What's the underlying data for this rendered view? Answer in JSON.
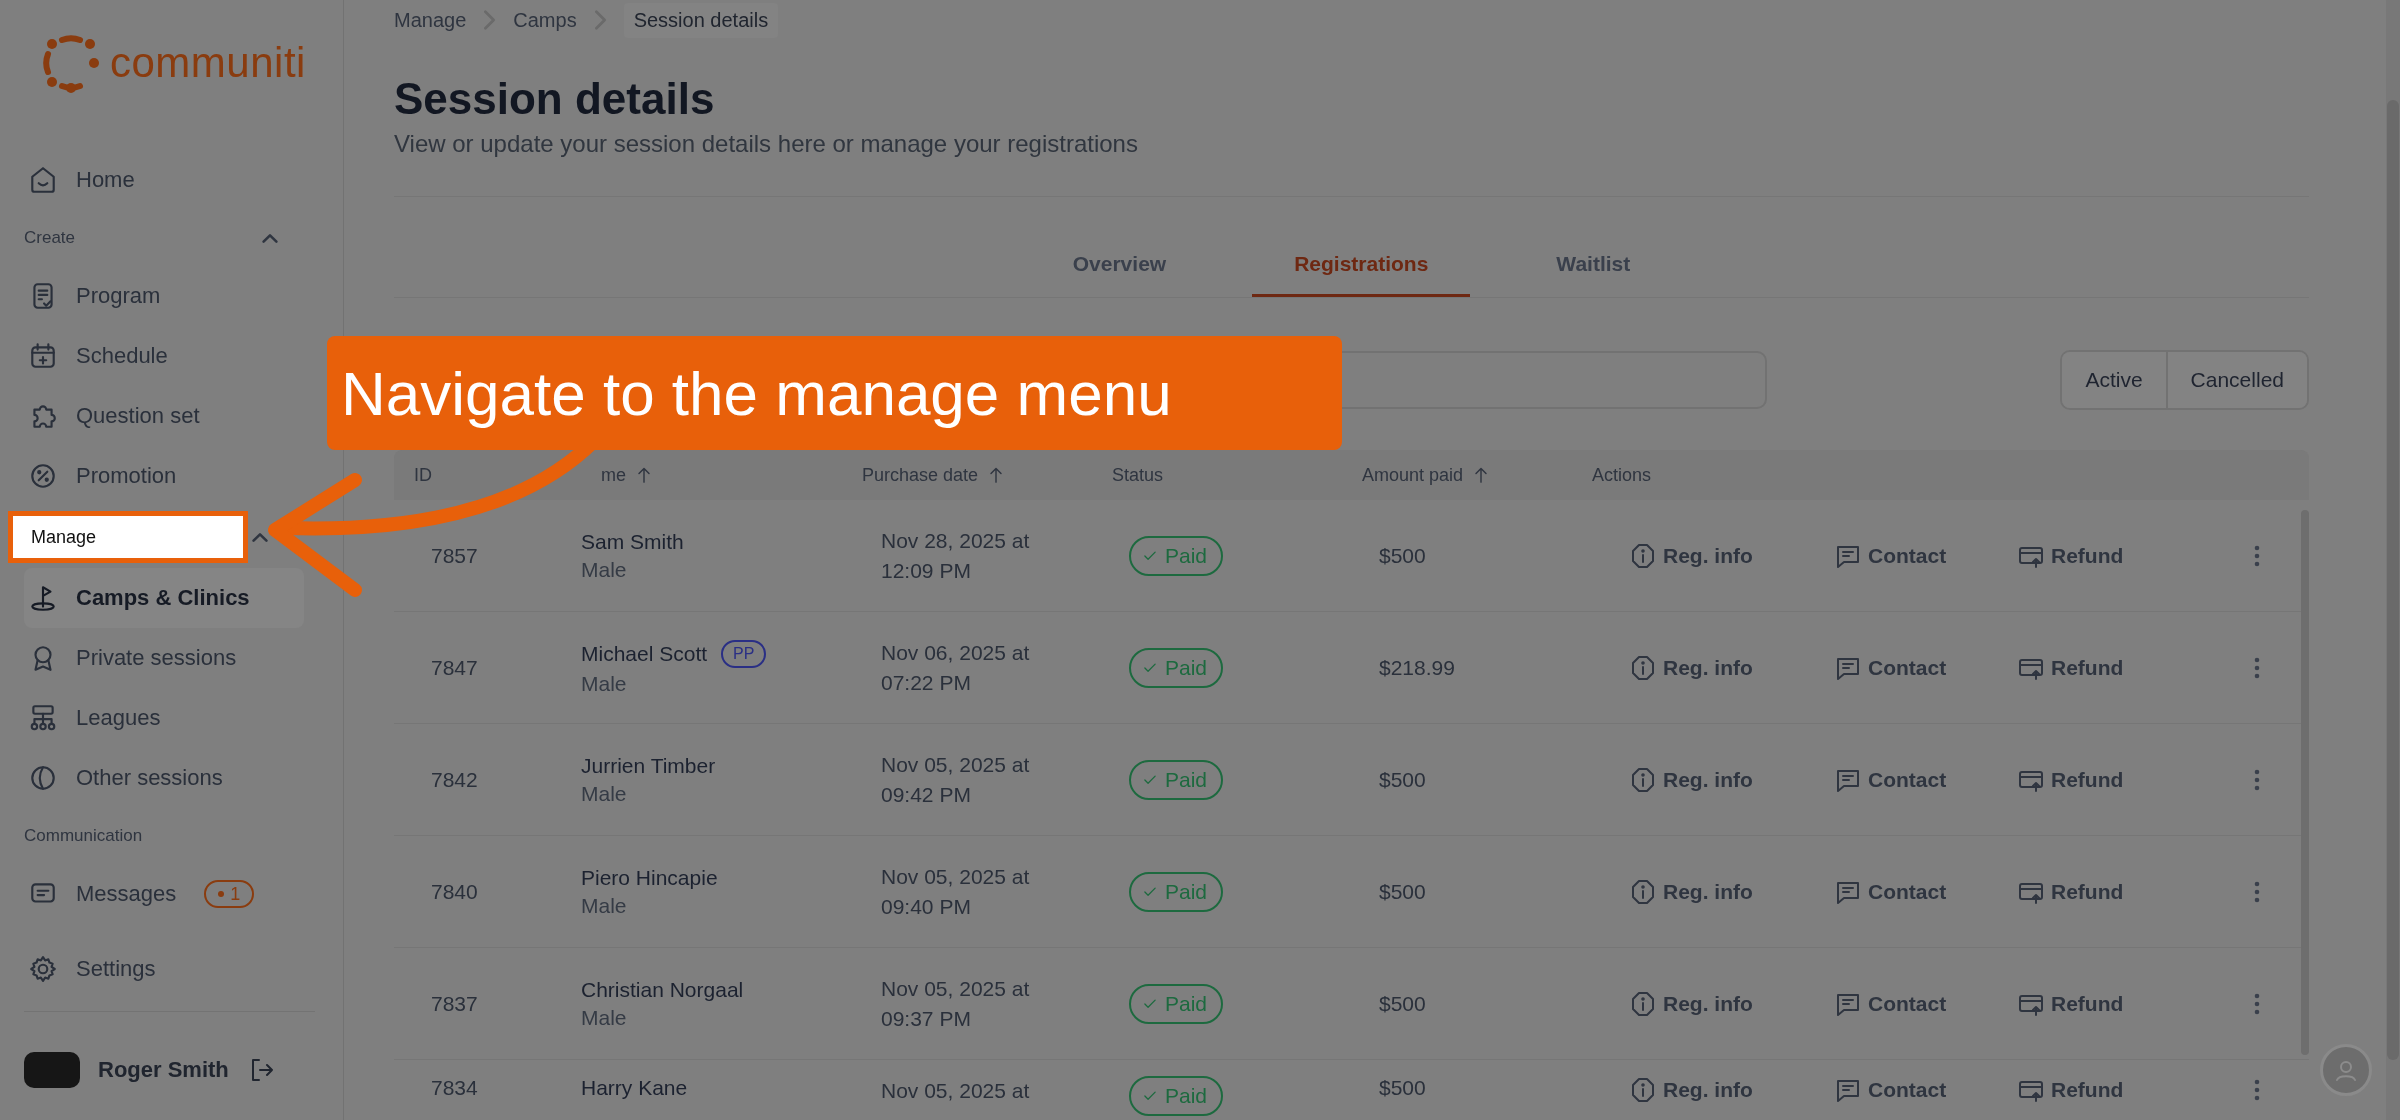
{
  "sidebar": {
    "logo": "communiti",
    "nav": [
      {
        "kind": "item",
        "label": "Home",
        "selected": false
      },
      {
        "kind": "section",
        "label": "Create",
        "expanded": true,
        "highlighted": false
      },
      {
        "kind": "item",
        "label": "Program",
        "selected": false
      },
      {
        "kind": "item",
        "label": "Schedule",
        "selected": false
      },
      {
        "kind": "item",
        "label": "Question set",
        "selected": false
      },
      {
        "kind": "item",
        "label": "Promotion",
        "selected": false
      },
      {
        "kind": "section",
        "label": "Manage",
        "expanded": true,
        "highlighted": true
      },
      {
        "kind": "item",
        "label": "Camps & Clinics",
        "selected": true
      },
      {
        "kind": "item",
        "label": "Private sessions",
        "selected": false
      },
      {
        "kind": "item",
        "label": "Leagues",
        "selected": false
      },
      {
        "kind": "item",
        "label": "Other sessions",
        "selected": false
      },
      {
        "kind": "section",
        "label": "Communication",
        "highlighted": false
      },
      {
        "kind": "item",
        "label": "Messages",
        "selected": false,
        "badge": "1"
      }
    ],
    "settings": "Settings",
    "user": "Roger Smith"
  },
  "breadcrumb": [
    {
      "label": "Manage",
      "current": false
    },
    {
      "label": "Camps",
      "current": false
    },
    {
      "label": "Session details",
      "current": true
    }
  ],
  "title": "Session details",
  "subtitle": "View or update your session details here or manage your registrations",
  "tabs": [
    {
      "label": "Overview",
      "selected": false
    },
    {
      "label": "Registrations",
      "selected": true
    },
    {
      "label": "Waitlist",
      "selected": false
    }
  ],
  "status_filter": [
    {
      "label": "Active"
    },
    {
      "label": "Cancelled"
    }
  ],
  "table": {
    "columns": [
      {
        "label": "ID",
        "sortable": false
      },
      {
        "label": "me",
        "sortable": true
      },
      {
        "label": "Purchase date",
        "sortable": true
      },
      {
        "label": "Status",
        "sortable": false
      },
      {
        "label": "Amount paid",
        "sortable": true
      },
      {
        "label": "Actions",
        "sortable": false
      }
    ],
    "rows": [
      {
        "id": "7857",
        "name": "Sam Smith",
        "gender": "Male",
        "purchase_date": "Nov 28, 2025 at 12:09 PM",
        "status": "Paid",
        "amount": "$500",
        "actions": [
          "Reg. info",
          "Contact",
          "Refund"
        ]
      },
      {
        "id": "7847",
        "name": "Michael Scott",
        "badge": "PP",
        "gender": "Male",
        "purchase_date": "Nov 06, 2025 at 07:22 PM",
        "status": "Paid",
        "amount": "$218.99",
        "actions": [
          "Reg. info",
          "Contact",
          "Refund"
        ]
      },
      {
        "id": "7842",
        "name": "Jurrien Timber",
        "gender": "Male",
        "purchase_date": "Nov 05, 2025 at 09:42 PM",
        "status": "Paid",
        "amount": "$500",
        "actions": [
          "Reg. info",
          "Contact",
          "Refund"
        ]
      },
      {
        "id": "7840",
        "name": "Piero Hincapie",
        "gender": "Male",
        "purchase_date": "Nov 05, 2025 at 09:40 PM",
        "status": "Paid",
        "amount": "$500",
        "actions": [
          "Reg. info",
          "Contact",
          "Refund"
        ]
      },
      {
        "id": "7837",
        "name": "Christian Norgaal",
        "gender": "Male",
        "purchase_date": "Nov 05, 2025 at 09:37 PM",
        "status": "Paid",
        "amount": "$500",
        "actions": [
          "Reg. info",
          "Contact",
          "Refund"
        ]
      },
      {
        "id": "7834",
        "name": "Harry Kane",
        "purchase_date": "Nov 05, 2025 at",
        "status": "Paid",
        "amount": "$500",
        "actions": [
          "Reg. info",
          "Contact",
          "Refund"
        ]
      }
    ]
  },
  "callout": "Navigate to the manage menu"
}
